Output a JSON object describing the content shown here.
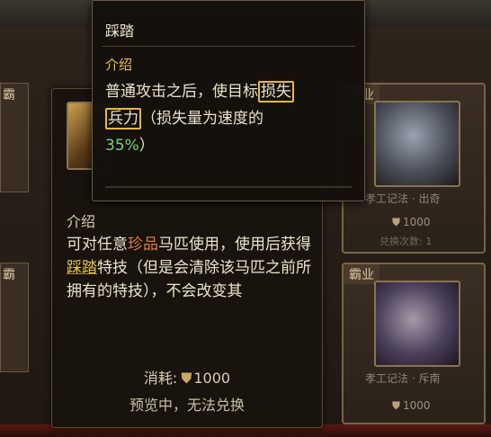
{
  "shop": {
    "cards": [
      {
        "tag": "霸业",
        "name": "孝工记法 · 出奇",
        "price": "1000",
        "count": "兑换次数: 1"
      },
      {
        "tag": "霸业",
        "name": "孝工记法 · 斥南",
        "price": "1000"
      }
    ],
    "left_tags": [
      "霸",
      "霸"
    ],
    "coin_icon": "shield-coin-icon"
  },
  "item_tooltip": {
    "section_title": "介绍",
    "desc_part1": "可对任意",
    "rare_word": "珍品",
    "desc_part2": "马匹使用，使用后获得",
    "skill_word": "踩踏",
    "desc_part3": "特技（但是会清除该马匹之前所拥有的特技），不会改变其",
    "cost_label": "消耗:",
    "cost_value": "1000",
    "preview_text": "预览中，无法兑换"
  },
  "skill_tooltip": {
    "title": "踩踏",
    "section_title": "介绍",
    "text1": "普通攻击之后，使目标",
    "boxed1": "损失",
    "boxed2": "兵力",
    "text2": "（损失量为速度的",
    "percent": "35%",
    "text3": "）"
  },
  "colors": {
    "highlight_rare": "#e07a3a",
    "highlight_skill": "#e8c44a",
    "box_border": "#e8b83a",
    "percent_green": "#7fd07a"
  }
}
